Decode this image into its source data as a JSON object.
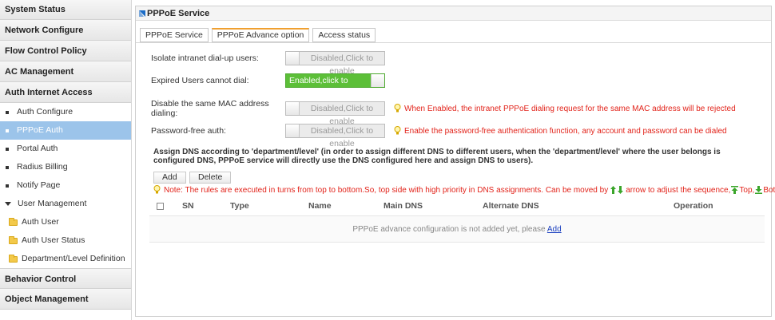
{
  "sidebar": {
    "headers": [
      "System Status",
      "Network Configure",
      "Flow Control Policy",
      "AC Management",
      "Auth Internet Access"
    ],
    "auth_items": [
      "Auth Configure",
      "PPPoE Auth",
      "Portal Auth",
      "Radius Billing",
      "Notify Page"
    ],
    "user_management": "User Management",
    "sub_items": [
      "Auth User",
      "Auth User Status",
      "Department/Level Definition"
    ],
    "bottom_headers": [
      "Behavior Control",
      "Object Management"
    ]
  },
  "panel": {
    "title": "PPPoE Service",
    "tabs": [
      "PPPoE Service",
      "PPPoE Advance option",
      "Access status"
    ]
  },
  "settings": {
    "isolate_label": "Isolate intranet dial-up users:",
    "isolate_state": "Disabled,Click to enable",
    "expired_label": "Expired Users cannot dial:",
    "expired_state": "Enabled,click to disable",
    "mac_label": "Disable the same MAC address dialing:",
    "mac_state": "Disabled,Click to enable",
    "mac_hint": "When Enabled, the intranet PPPoE dialing request for the same MAC address will be rejected",
    "pwfree_label": "Password-free auth:",
    "pwfree_state": "Disabled,Click to enable",
    "pwfree_hint": "Enable the password-free authentication function, any account and password can be dialed"
  },
  "dns": {
    "assign_text": "Assign DNS according to 'department/level' (in order to assign different DNS to different users, when the 'department/level' where the user belongs is configured DNS, PPPoE service will directly use the DNS configured here and assign DNS to users).",
    "add_label": "Add",
    "delete_label": "Delete",
    "note": "Note: The rules are executed in turns from top to bottom.So, top side with high priority in DNS assignments. Can be moved by",
    "note_arrows": "arrow to adjust the sequence,",
    "note_top": "Top,",
    "note_bottom": "Bottom",
    "columns": [
      "SN",
      "Type",
      "Name",
      "Main DNS",
      "Alternate DNS",
      "Operation"
    ],
    "empty_text": "PPPoE advance configuration is not added yet, please",
    "empty_link": "Add"
  }
}
